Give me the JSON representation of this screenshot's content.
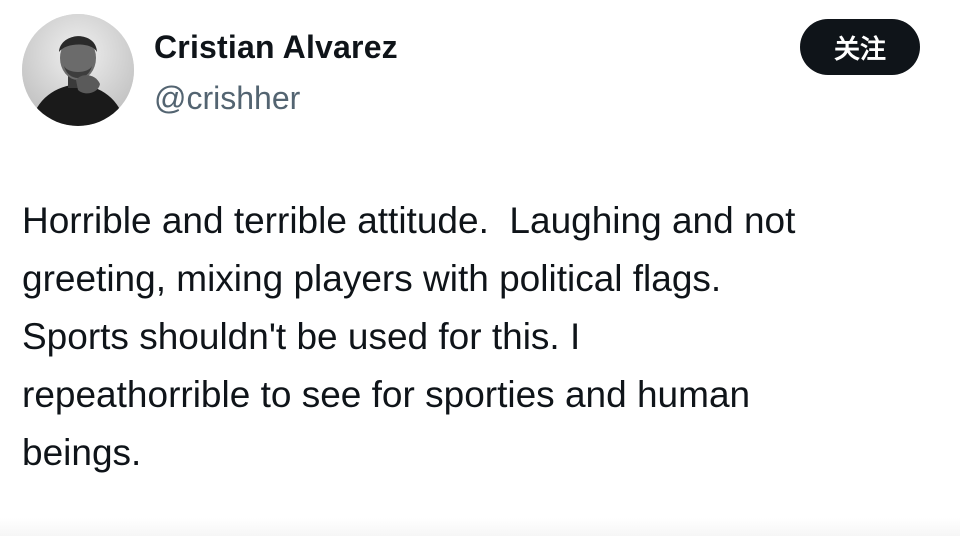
{
  "author": {
    "display_name": "Cristian Alvarez",
    "handle": "@crishher",
    "avatar_icon": "profile-photo-avatar"
  },
  "actions": {
    "follow_label": "关注"
  },
  "tweet": {
    "text": "Horrible and terrible attitude.  Laughing and not\ngreeting, mixing players with political flags.\nSports shouldn't be used for this. I\nrepeathorrible to see for sporties and human\nbeings."
  },
  "colors": {
    "text_primary": "#0f1419",
    "text_secondary": "#536471",
    "button_bg": "#0f1419",
    "button_text": "#ffffff"
  }
}
